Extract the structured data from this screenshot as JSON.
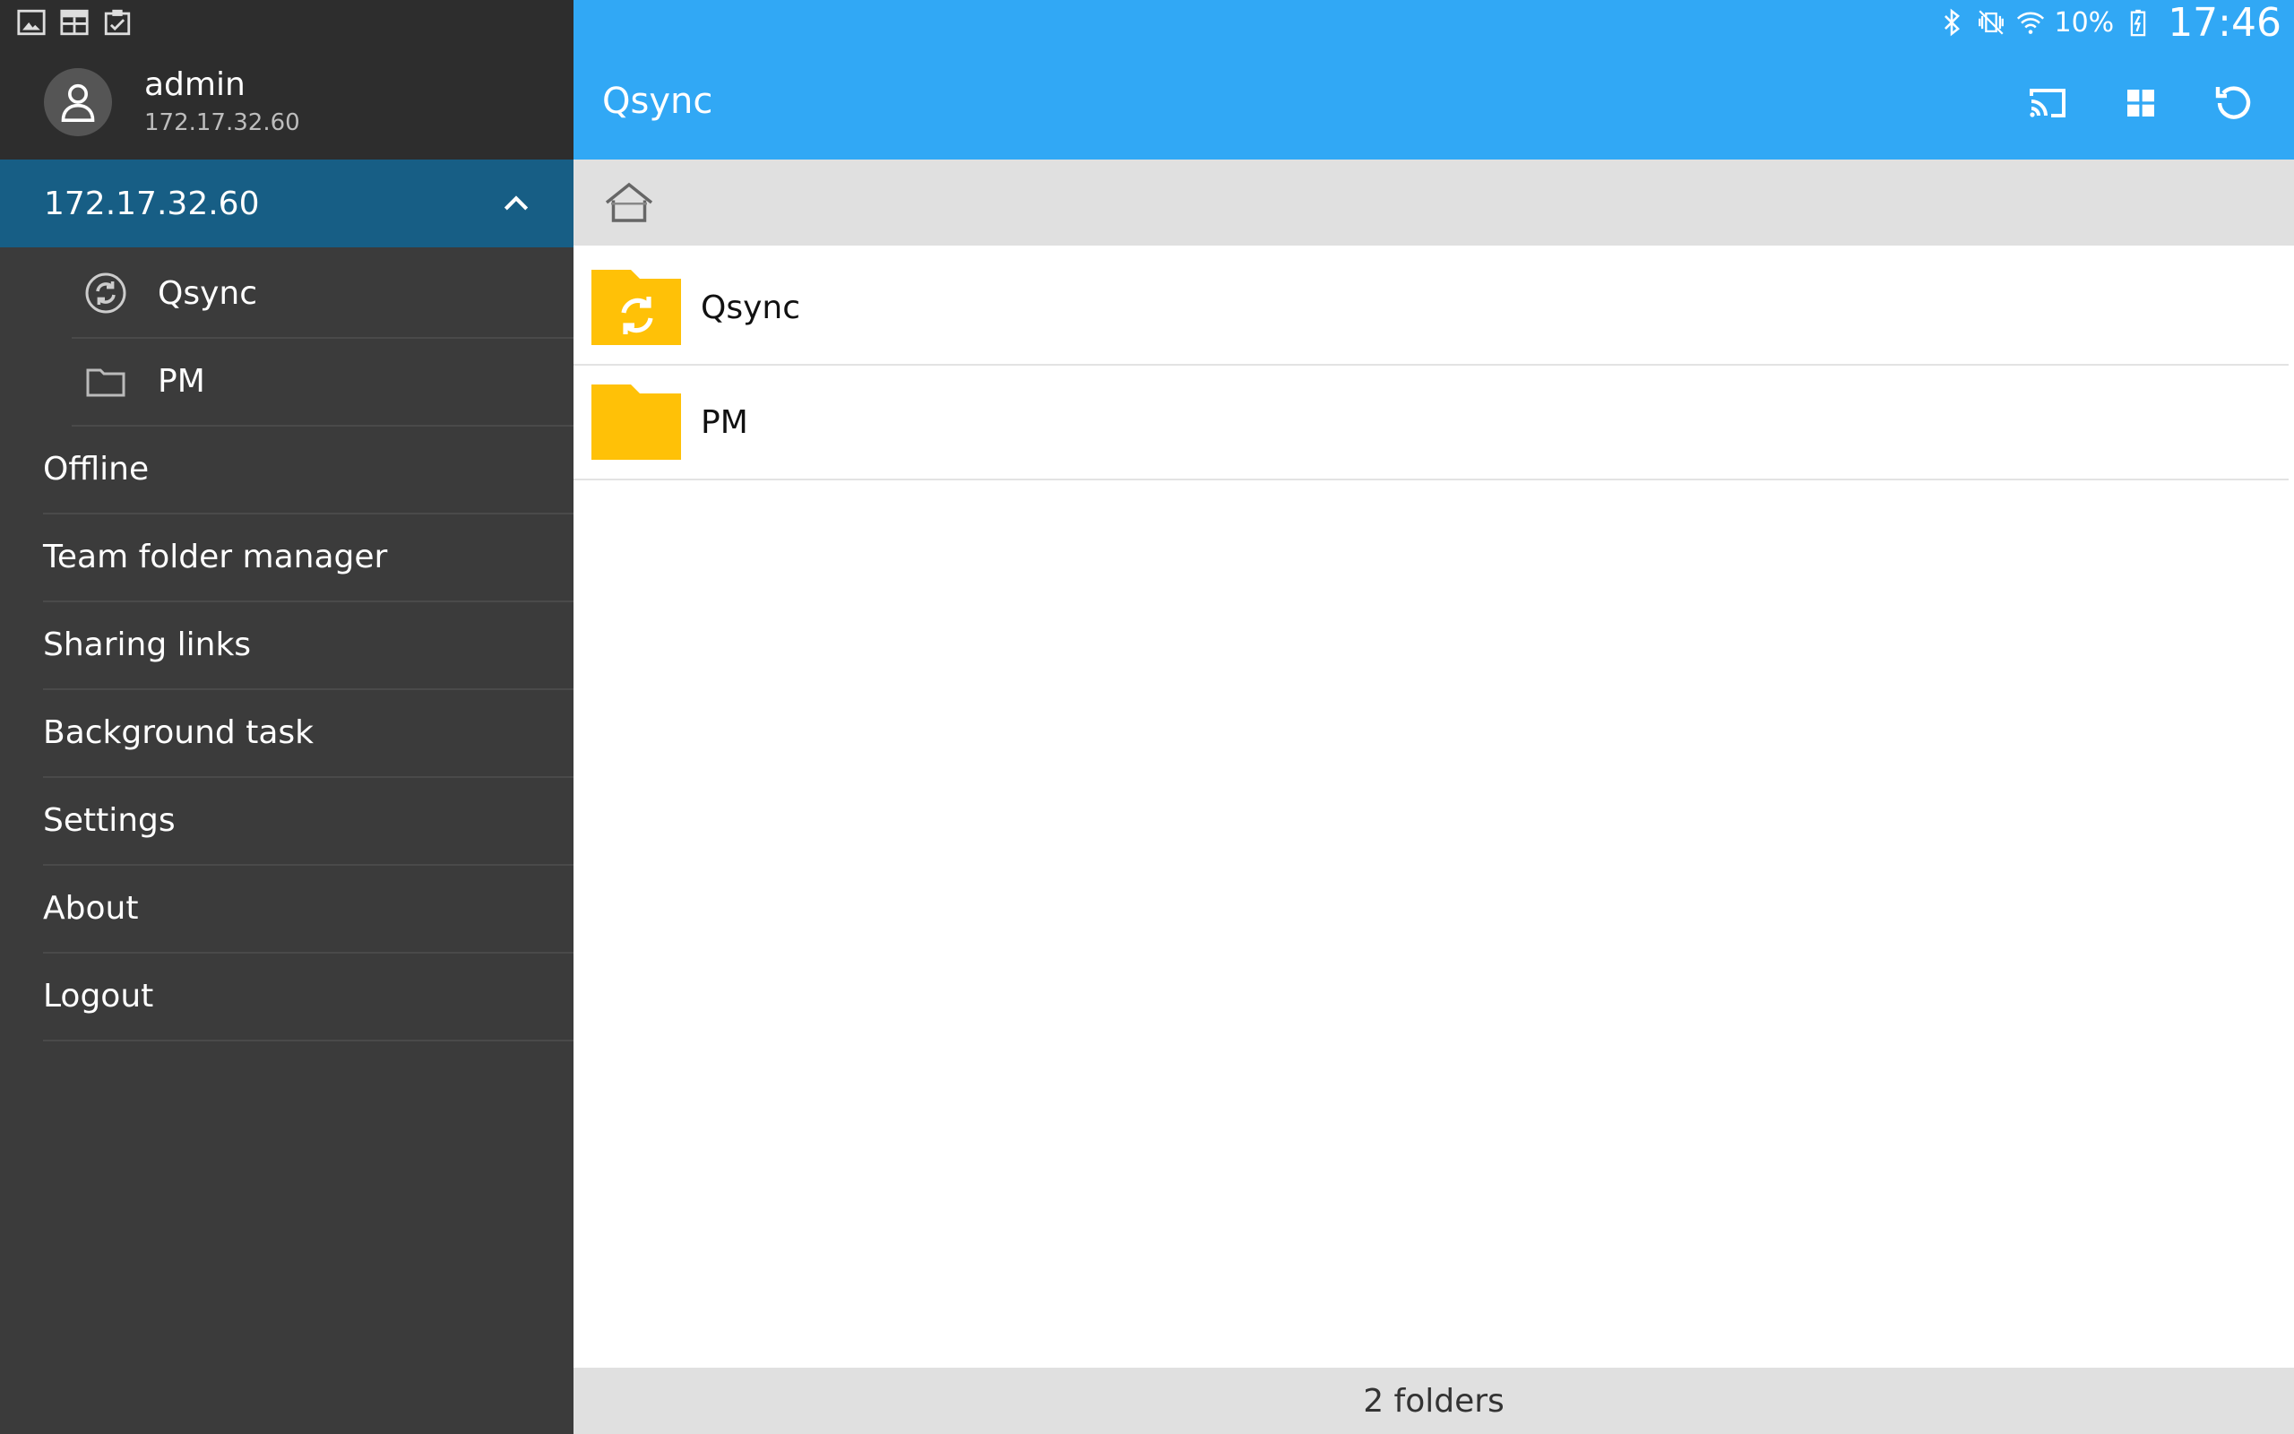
{
  "drawer": {
    "user": {
      "name": "admin",
      "host": "172.17.32.60"
    },
    "server": {
      "label": "172.17.32.60"
    },
    "sub_items": [
      {
        "label": "Qsync",
        "icon": "sync-icon"
      },
      {
        "label": "PM",
        "icon": "folder-outline-icon"
      }
    ],
    "menu": [
      {
        "label": "Offline"
      },
      {
        "label": "Team folder manager"
      },
      {
        "label": "Sharing links"
      },
      {
        "label": "Background task"
      },
      {
        "label": "Settings"
      },
      {
        "label": "About"
      },
      {
        "label": "Logout"
      }
    ]
  },
  "status": {
    "battery": "10%",
    "time": "17:46"
  },
  "appbar": {
    "title": "Qsync"
  },
  "files": [
    {
      "name": "Qsync",
      "icon": "sync-folder-icon"
    },
    {
      "name": "PM",
      "icon": "folder-icon"
    }
  ],
  "footer": {
    "summary": "2 folders"
  },
  "colors": {
    "accent": "#31a8f5",
    "drawer": "#3b3b3b",
    "selected": "#175e85",
    "folder": "#ffc107"
  }
}
